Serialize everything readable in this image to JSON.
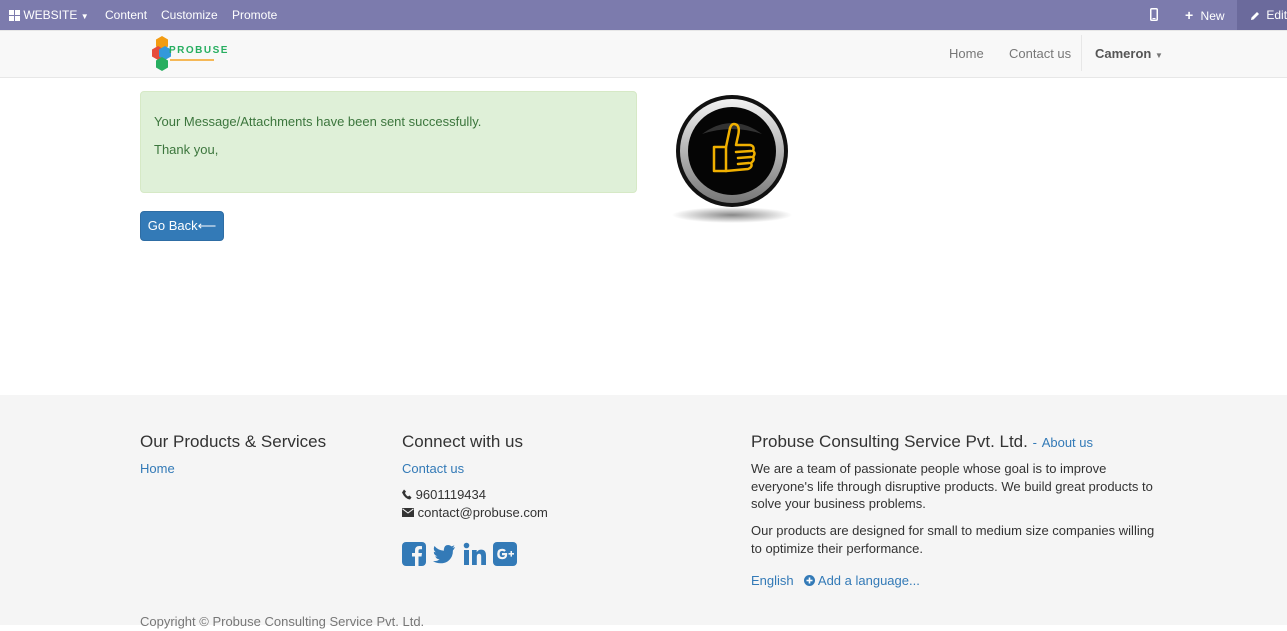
{
  "admin_bar": {
    "website_label": "WEBSITE",
    "menu": [
      "Content",
      "Customize",
      "Promote"
    ],
    "new_label": "New",
    "edit_label": "Edit",
    "background": "#7c7bad"
  },
  "header": {
    "logo_text": "PROBUSE",
    "nav": [
      "Home",
      "Contact us"
    ],
    "user_label": "Cameron"
  },
  "main": {
    "alert_line1": "Your Message/Attachments have been sent successfully.",
    "alert_line2": "Thank you,",
    "back_button": "Go Back⟵",
    "image": "thumbs-up-icon"
  },
  "footer": {
    "col1_title": "Our Products & Services",
    "col1_link": "Home",
    "col2_title": "Connect with us",
    "col2_link": "Contact us",
    "phone": "9601119434",
    "email": "contact@probuse.com",
    "social_icons": [
      "facebook-icon",
      "twitter-icon",
      "linkedin-icon",
      "google-plus-icon"
    ],
    "col3_title": "Probuse Consulting Service Pvt. Ltd.",
    "col3_about_link": "About us",
    "col3_para1": "We are a team of passionate people whose goal is to improve everyone's life through disruptive products. We build great products to solve your business problems.",
    "col3_para2": "Our products are designed for small to medium size companies willing to optimize their performance.",
    "lang_current": "English",
    "lang_add": "Add a language...",
    "copyright": "Copyright © Probuse Consulting Service Pvt. Ltd."
  }
}
